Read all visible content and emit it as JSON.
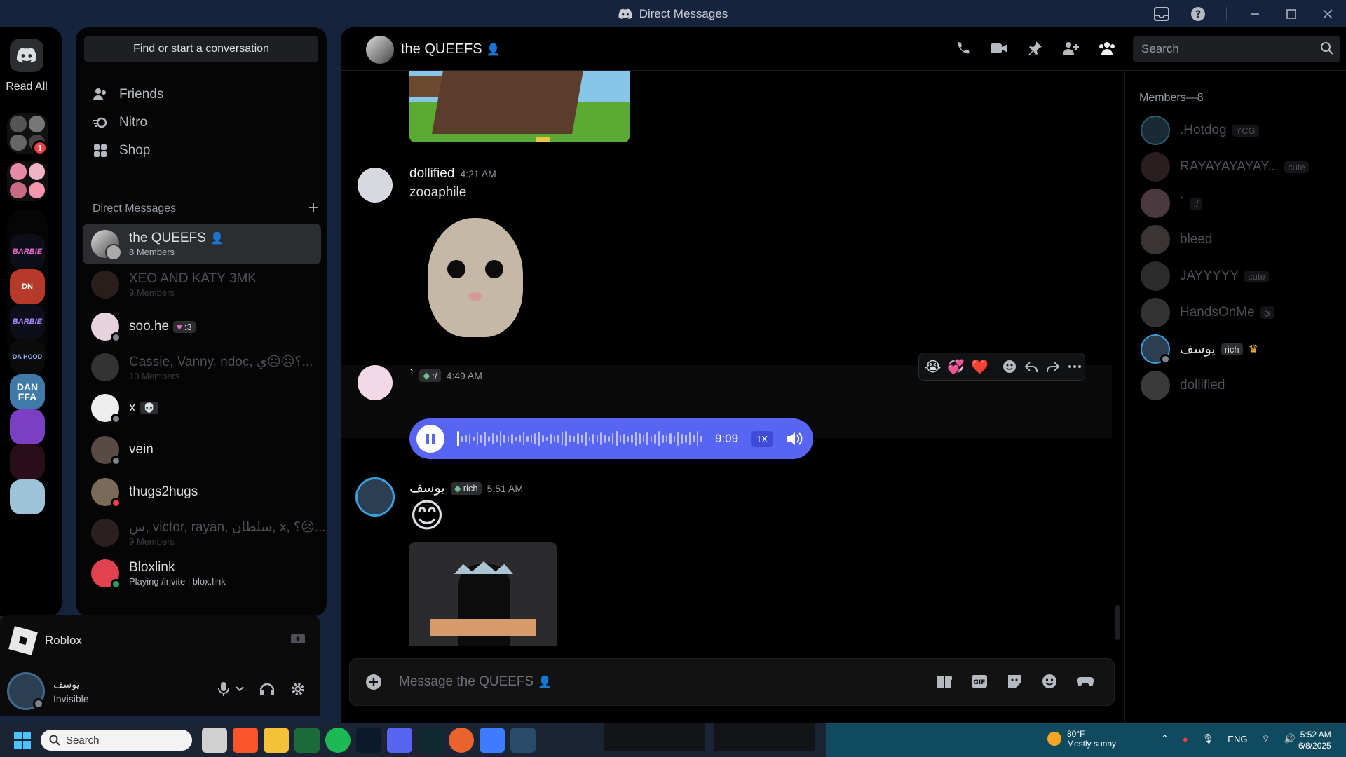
{
  "window": {
    "title": "Direct Messages"
  },
  "rail": {
    "read_all": "Read All",
    "badge_count": "1",
    "servers": [
      "BARBIE",
      "DN",
      "BARBIE",
      "DA HOOD",
      "DAN FFA",
      "",
      "",
      ""
    ]
  },
  "dm_sidebar": {
    "search_label": "Find or start a conversation",
    "nav": [
      {
        "label": "Friends",
        "icon": "friends-icon"
      },
      {
        "label": "Nitro",
        "icon": "nitro-icon"
      },
      {
        "label": "Shop",
        "icon": "shop-icon"
      }
    ],
    "section_title": "Direct Messages",
    "items": [
      {
        "name": "the QUEEFS",
        "sub": "8 Members",
        "active": true,
        "muted": false,
        "tag": ""
      },
      {
        "name": "XEO AND KATY 3MK",
        "sub": "9 Members",
        "active": false,
        "muted": true,
        "tag": ""
      },
      {
        "name": "soo.he",
        "sub": "",
        "active": false,
        "muted": false,
        "tag": ":3"
      },
      {
        "name": "Cassie, Vanny, ndoc, ؟☹☹ي...",
        "sub": "10 Members",
        "active": false,
        "muted": true,
        "tag": ""
      },
      {
        "name": "x",
        "sub": "",
        "active": false,
        "muted": false,
        "tag": "💀"
      },
      {
        "name": "vein",
        "sub": "",
        "active": false,
        "muted": false,
        "tag": ""
      },
      {
        "name": "thugs2hugs",
        "sub": "",
        "active": false,
        "muted": false,
        "tag": ""
      },
      {
        "name": "س, victor, rayan, سلطان, x, ؟☹...",
        "sub": "9 Members",
        "active": false,
        "muted": true,
        "tag": ""
      },
      {
        "name": "Bloxlink",
        "sub": "Playing /invite | blox.link",
        "active": false,
        "muted": false,
        "tag": ""
      }
    ]
  },
  "activity": {
    "game": "Roblox"
  },
  "user_panel": {
    "name": "يوسف",
    "status": "Invisible"
  },
  "chat": {
    "title": "the QUEEFS",
    "search_placeholder": "Search",
    "messages": [
      {
        "author": "dollified",
        "time": "4:21 AM",
        "text": "zooaphile"
      },
      {
        "author": "`",
        "tag": ":/",
        "time": "4:49 AM",
        "text": ""
      },
      {
        "author": "يوسف",
        "tag": "rich",
        "time": "5:51 AM",
        "text": "😊"
      }
    ],
    "voice": {
      "duration": "9:09",
      "speed": "1X"
    },
    "reactions": [
      "😭",
      "💞",
      "❤️"
    ],
    "composer_placeholder": "Message the QUEEFS"
  },
  "members": {
    "title": "Members—8",
    "list": [
      {
        "name": ".Hotdog",
        "tag": "YCG",
        "active": false
      },
      {
        "name": "RAYAYAYAYAY...",
        "tag": "cute",
        "active": false
      },
      {
        "name": "`",
        "tag": ":/",
        "active": false
      },
      {
        "name": "bleed",
        "tag": "",
        "active": false
      },
      {
        "name": "JAYYYYY",
        "tag": "cute",
        "active": false
      },
      {
        "name": "HandsOnMe",
        "tag": "ئ",
        "active": false
      },
      {
        "name": "يوسف",
        "tag": "rich",
        "active": true
      },
      {
        "name": "dollified",
        "tag": "",
        "active": false
      }
    ]
  },
  "taskbar": {
    "search_label": "Search",
    "weather_temp": "80°F",
    "weather_desc": "Mostly sunny",
    "lang": "ENG",
    "time": "5:52 AM",
    "date": "6/8/2025"
  }
}
